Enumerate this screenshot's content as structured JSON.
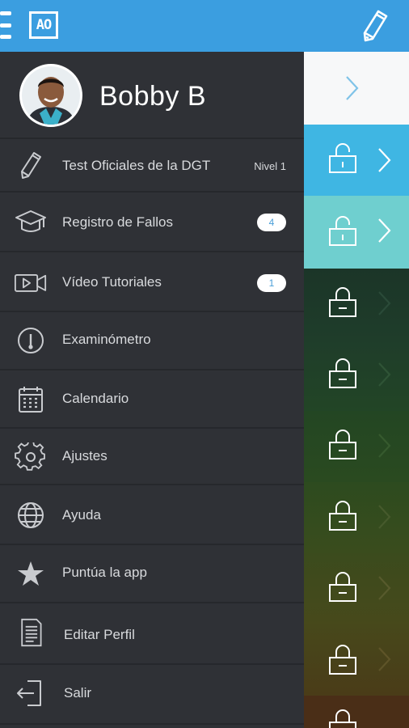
{
  "topbar": {
    "logo_text": "AO",
    "menu_icon": "hamburger-icon",
    "edit_icon": "pencil-icon",
    "color": "#3b9ee0"
  },
  "profile": {
    "name": "Bobby B"
  },
  "menu": [
    {
      "label": "Test Oficiales de la DGT",
      "icon": "pencil-icon",
      "badge_text": "Nivel 1"
    },
    {
      "label": "Registro de Fallos",
      "icon": "graduation-cap-icon",
      "badge": "4"
    },
    {
      "label": "Vídeo Tutoriales",
      "icon": "video-camera-icon",
      "badge": "1"
    },
    {
      "label": "Examinómetro",
      "icon": "gauge-icon"
    },
    {
      "label": "Calendario",
      "icon": "calendar-icon"
    },
    {
      "label": "Ajustes",
      "icon": "gear-icon"
    },
    {
      "label": "Ayuda",
      "icon": "globe-icon"
    },
    {
      "label": "Puntúa la app",
      "icon": "star-icon"
    },
    {
      "label": "Editar Perfil",
      "icon": "document-icon"
    },
    {
      "label": "Salir",
      "icon": "exit-icon"
    }
  ],
  "strip": {
    "rows": [
      {
        "state": "chevron",
        "color": "#f7f8f9"
      },
      {
        "state": "unlocked",
        "color": "#3fb6e3"
      },
      {
        "state": "unlocked",
        "color": "#6fcfcf"
      },
      {
        "state": "locked",
        "color": "#1d3a2a"
      },
      {
        "state": "locked",
        "color": "#1f4126"
      },
      {
        "state": "locked",
        "color": "#254821"
      },
      {
        "state": "locked",
        "color": "#344b1f"
      },
      {
        "state": "locked",
        "color": "#434a1c"
      },
      {
        "state": "locked",
        "color": "#4a3f18"
      },
      {
        "state": "locked",
        "color": "#4a2c16"
      }
    ]
  }
}
